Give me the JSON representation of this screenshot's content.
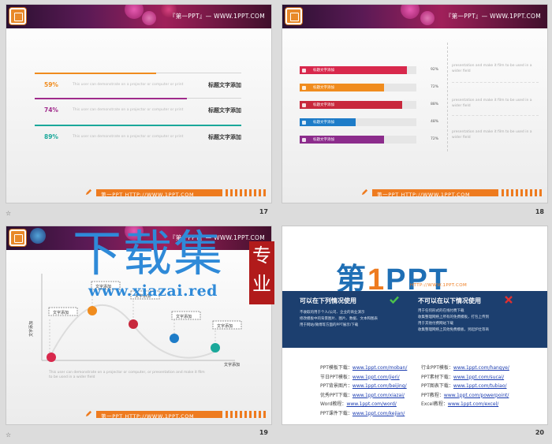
{
  "common": {
    "banner_title": "『第一PPT』— WWW.1PPT.COM",
    "footer_text": "第一PPT HTTP://WWW.1PPT.COM",
    "star": "☆"
  },
  "slide17": {
    "number": "17",
    "rows": [
      {
        "pct": "59%",
        "desc": "This user can demonstrate on a projector or computer or print",
        "title": "标题文字添加",
        "color": "#f08c1e"
      },
      {
        "pct": "74%",
        "desc": "This user can demonstrate on a projector or computer or print",
        "title": "标题文字添加",
        "color": "#a02c8c"
      },
      {
        "pct": "89%",
        "desc": "This user can demonstrate on a projector or computer or print",
        "title": "标题文字添加",
        "color": "#1aa89a"
      }
    ]
  },
  "slide18": {
    "number": "18",
    "bars": [
      {
        "label": "标题文字添加",
        "value": "92%",
        "color": "#d8284c"
      },
      {
        "label": "标题文字添加",
        "value": "72%",
        "color": "#f08c1e"
      },
      {
        "label": "标题文字添加",
        "value": "88%",
        "color": "#c8283c"
      },
      {
        "label": "标题文字添加",
        "value": "48%",
        "color": "#1e7cc8"
      },
      {
        "label": "标题文字添加",
        "value": "72%",
        "color": "#8c2c8c"
      }
    ],
    "right_texts": [
      "presentation and make it film to be used in a wider field",
      "presentation and make it film to be used in a wider field",
      "presentation and make it film to be used in a wider field"
    ]
  },
  "slide19": {
    "number": "19",
    "ylabel": "文字添加",
    "xlabel": "文字添加",
    "callouts": [
      "文字添加",
      "文字添加",
      "文字添加",
      "文字添加",
      "文字添加"
    ],
    "desc": "This user can demonstrate on a projector or computer, or presentation and make it film to be used in a wider field",
    "watermark_main": "下载集",
    "watermark_url": "www.xiazai.red",
    "stamp_chars": [
      "专",
      "业"
    ]
  },
  "slide20": {
    "number": "20",
    "logo_a": "第",
    "logo_b": "1",
    "logo_c": "PPT",
    "logo_http": "HTTP://WWW.1PPT.COM",
    "can_title": "可以在下列情况使用",
    "cannot_title": "不可以在以下情况使用",
    "can_items": [
      "不收取的用于个人/公司、企业的商业演示",
      "修改模板中的背景图片、图片、数据、文本和图表",
      "用于网站/微博等方面的PPT展示/下载"
    ],
    "cannot_items": [
      "用于任何形式的在线付费下载",
      "收集整理网络上所有的免费模板，打包上传到",
      "用于其他付费网站下载",
      "收集整理网络上其他免费模板，另起炉灶等商"
    ],
    "links_left": [
      {
        "k": "PPT模板下载：",
        "v": "www.1ppt.com/moban/"
      },
      {
        "k": "节日PPT模板：",
        "v": "www.1ppt.com/jieri/"
      },
      {
        "k": "PPT背景图片：",
        "v": "www.1ppt.com/beijing/"
      },
      {
        "k": "优秀PPT下载：",
        "v": "www.1ppt.com/xiazai/"
      },
      {
        "k": "Word教程：",
        "v": "www.1ppt.com/word/"
      },
      {
        "k": "PPT课件下载：",
        "v": "www.1ppt.com/kejian/"
      }
    ],
    "links_right": [
      {
        "k": "行业PPT模板：",
        "v": "www.1ppt.com/hangye/"
      },
      {
        "k": "PPT素材下载：",
        "v": "www.1ppt.com/sucai/"
      },
      {
        "k": "PPT图表下载：",
        "v": "www.1ppt.com/tubiao/"
      },
      {
        "k": "PPT教程：",
        "v": "www.1ppt.com/powerpoint/"
      },
      {
        "k": "Excel教程：",
        "v": "www.1ppt.com/excel/"
      }
    ]
  }
}
